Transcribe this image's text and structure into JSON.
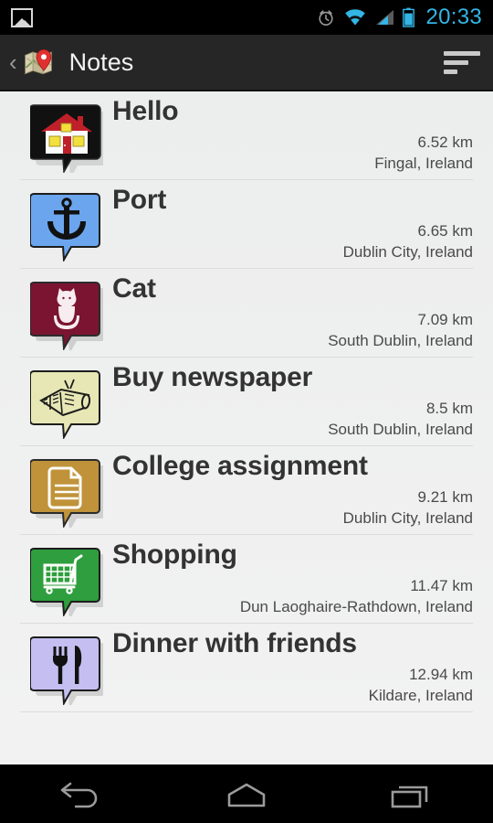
{
  "status_bar": {
    "time": "20:33",
    "notification_icon": "image-icon",
    "icons": [
      "alarm-clock-icon",
      "wifi-icon",
      "cellular-signal-icon",
      "battery-icon"
    ],
    "accent_color": "#33b5e5",
    "background_color": "#000000"
  },
  "action_bar": {
    "up_chevron": "‹",
    "app_icon": "map-pin-icon",
    "title": "Notes",
    "sort_icon": "sort-icon",
    "background_color": "#262626"
  },
  "notes": [
    {
      "title": "Hello",
      "distance": "6.52 km",
      "place": "Fingal, Ireland",
      "marker_color": "#111111",
      "marker_icon": "house-icon"
    },
    {
      "title": "Port",
      "distance": "6.65 km",
      "place": "Dublin City, Ireland",
      "marker_color": "#6BA5EE",
      "marker_icon": "anchor-icon"
    },
    {
      "title": "Cat",
      "distance": "7.09 km",
      "place": "South Dublin, Ireland",
      "marker_color": "#7B1430",
      "marker_icon": "cat-icon"
    },
    {
      "title": "Buy newspaper",
      "distance": "8.5 km",
      "place": "South Dublin, Ireland",
      "marker_color": "#E7E7B5",
      "marker_icon": "newspaper-icon"
    },
    {
      "title": "College assignment",
      "distance": "9.21 km",
      "place": "Dublin City, Ireland",
      "marker_color": "#C0933A",
      "marker_icon": "document-icon"
    },
    {
      "title": "Shopping",
      "distance": "11.47 km",
      "place": "Dun Laoghaire-Rathdown, Ireland",
      "marker_color": "#2E9E3E",
      "marker_icon": "shopping-cart-icon"
    },
    {
      "title": "Dinner with friends",
      "distance": "12.94 km",
      "place": "Kildare, Ireland",
      "marker_color": "#C4BFF0",
      "marker_icon": "cutlery-icon"
    }
  ],
  "nav_bar": {
    "buttons": [
      {
        "name": "back-button",
        "icon": "back-arrow-icon"
      },
      {
        "name": "home-button",
        "icon": "home-icon"
      },
      {
        "name": "recents-button",
        "icon": "recent-apps-icon"
      }
    ],
    "background_color": "#000000"
  }
}
